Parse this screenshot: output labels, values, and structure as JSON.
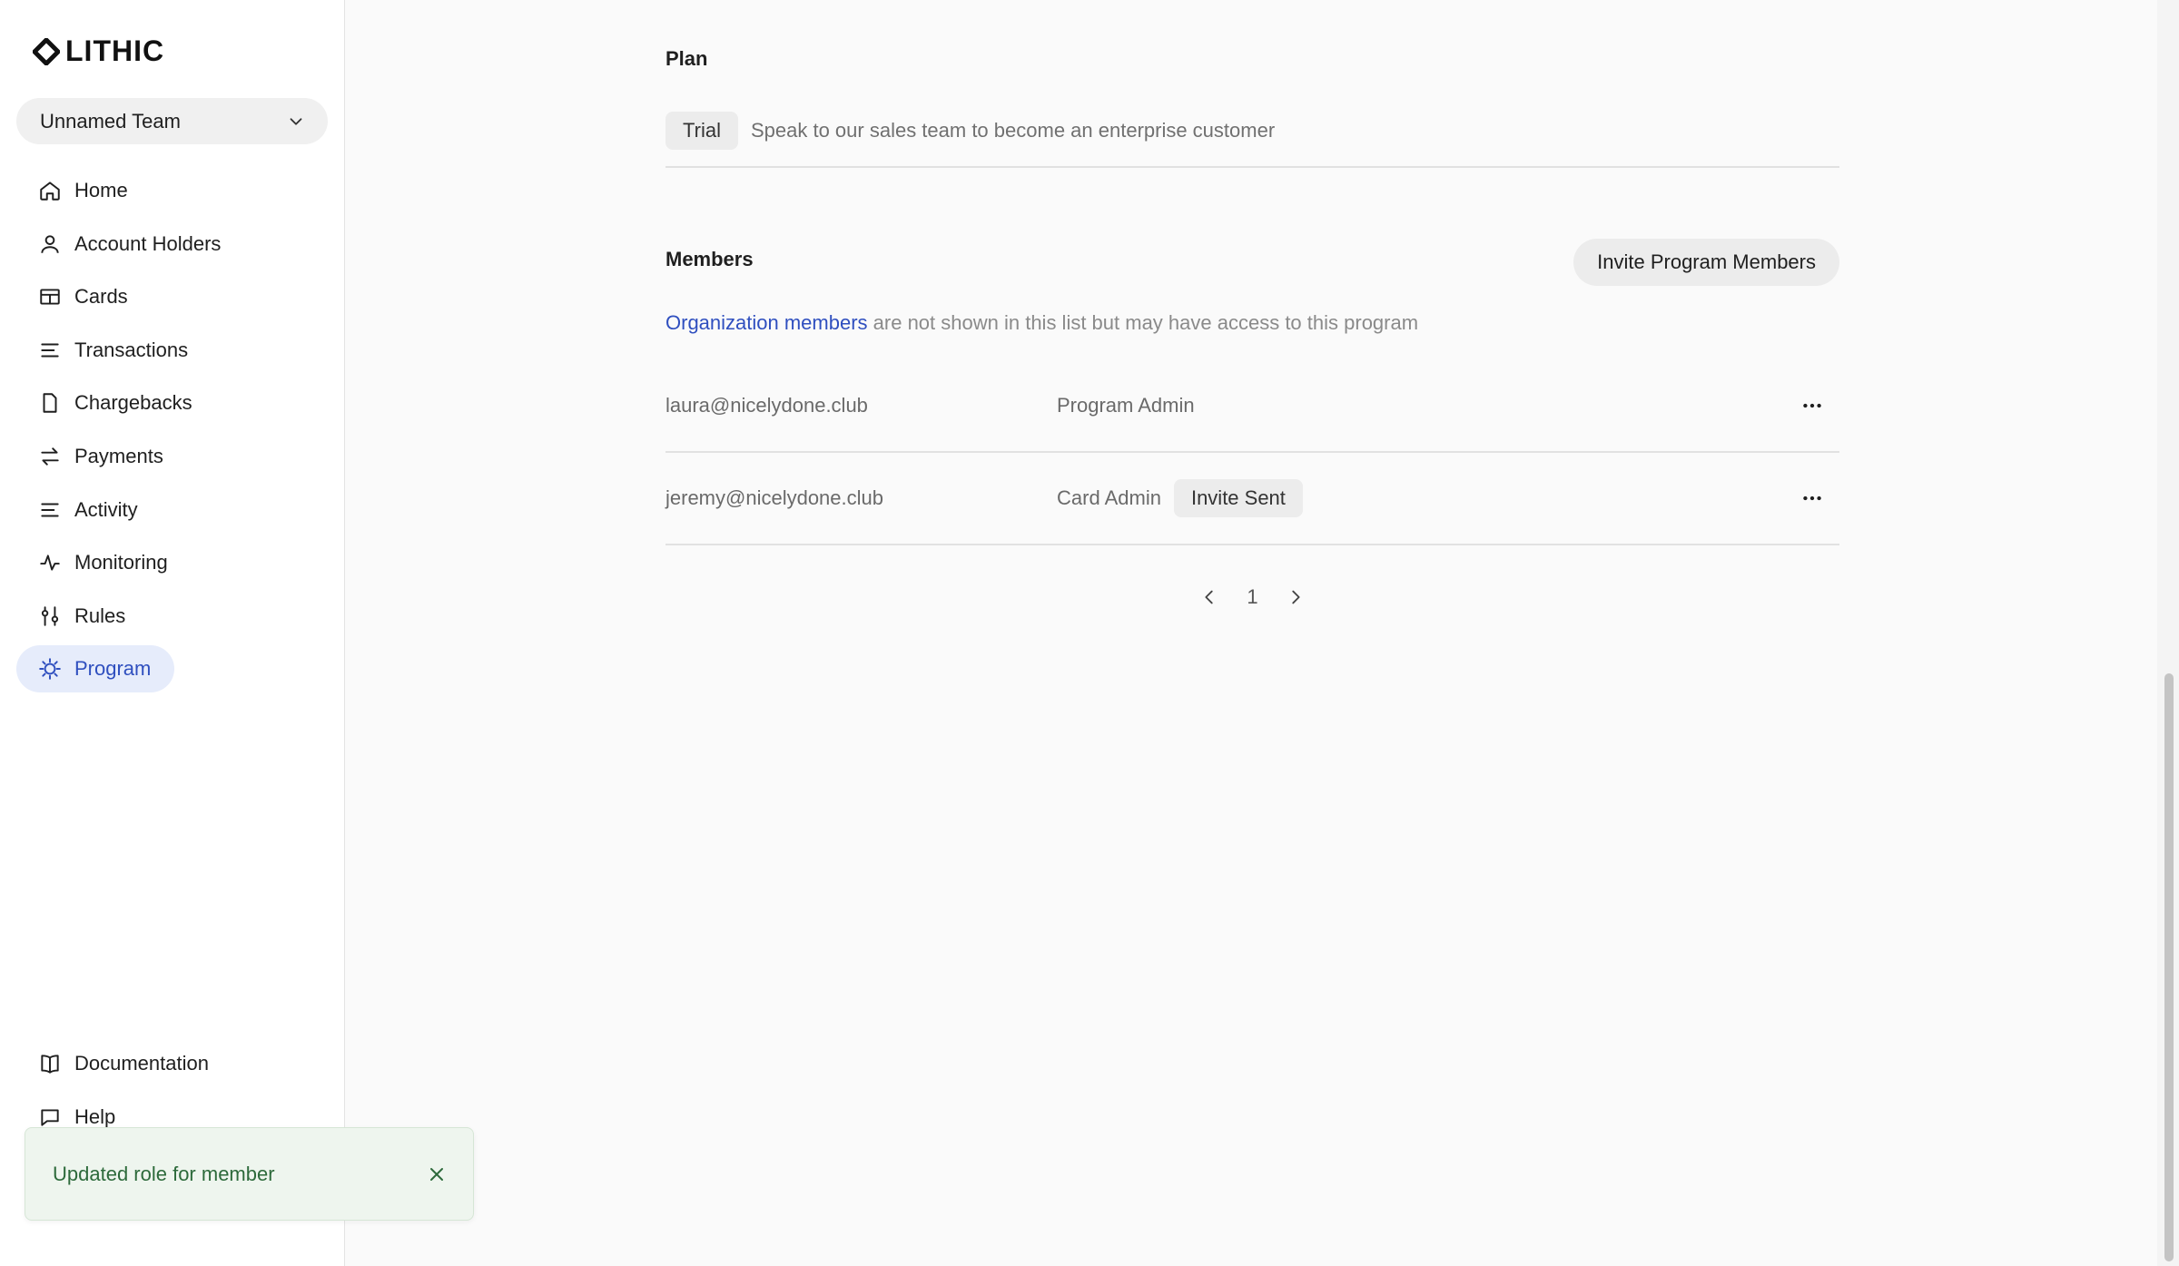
{
  "brand": {
    "name": "LITHIC"
  },
  "team_selector": {
    "value": "Unnamed Team"
  },
  "sidebar": {
    "items": [
      {
        "label": "Home",
        "icon": "home-icon"
      },
      {
        "label": "Account Holders",
        "icon": "user-icon"
      },
      {
        "label": "Cards",
        "icon": "card-icon"
      },
      {
        "label": "Transactions",
        "icon": "list-icon"
      },
      {
        "label": "Chargebacks",
        "icon": "document-icon"
      },
      {
        "label": "Payments",
        "icon": "arrows-icon"
      },
      {
        "label": "Activity",
        "icon": "list-icon"
      },
      {
        "label": "Monitoring",
        "icon": "pulse-icon"
      },
      {
        "label": "Rules",
        "icon": "sliders-icon"
      },
      {
        "label": "Program",
        "icon": "gear-icon",
        "active": true
      }
    ],
    "bottom_items": [
      {
        "label": "Documentation",
        "icon": "book-icon"
      },
      {
        "label": "Help",
        "icon": "chat-icon"
      }
    ]
  },
  "plan": {
    "title": "Plan",
    "badge": "Trial",
    "description": "Speak to our sales team to become an enterprise customer"
  },
  "members": {
    "title": "Members",
    "invite_button": "Invite Program Members",
    "note_link": "Organization members",
    "note_text": " are not shown in this list but may have access to this program",
    "rows": [
      {
        "email": "laura@nicelydone.club",
        "role": "Program Admin",
        "status": ""
      },
      {
        "email": "jeremy@nicelydone.club",
        "role": "Card Admin",
        "status": "Invite Sent"
      }
    ]
  },
  "pagination": {
    "current_page": "1"
  },
  "toast": {
    "message": "Updated role for member"
  },
  "colors": {
    "accent": "#2f4fbf",
    "active_bg": "#e6ecfb",
    "toast_bg": "#eef5ee",
    "toast_text": "#2d6a3b"
  }
}
